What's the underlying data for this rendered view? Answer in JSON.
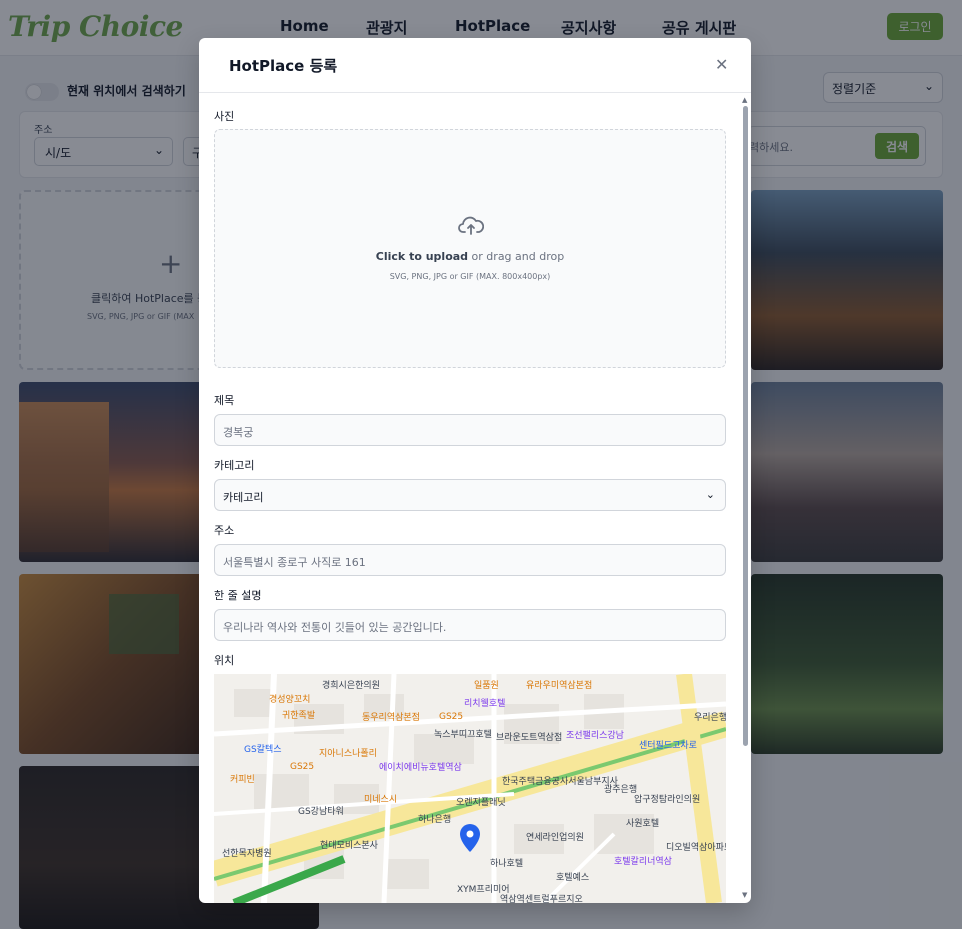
{
  "brand": {
    "logo": "Trip Choice",
    "accent": "#6aa834"
  },
  "nav": {
    "items": [
      "Home",
      "관광지",
      "HotPlace",
      "공지사항",
      "공유 게시판"
    ],
    "login": "로그인"
  },
  "filters": {
    "location_toggle_label": "현재 위치에서 검색하기",
    "sort_value": "정렬기준",
    "address_label": "주소",
    "sido_value": "시/도",
    "gu_value": "구",
    "keyword_placeholder": "력하세요.",
    "search_button": "검색"
  },
  "add_card": {
    "text": "클릭하여 HotPlace를 등",
    "sub": "SVG, PNG, JPG or GIF (MAX"
  },
  "modal": {
    "title": "HotPlace 등록",
    "photo_label": "사진",
    "upload_click": "Click to upload",
    "upload_rest": " or drag and drop",
    "upload_sub": "SVG, PNG, JPG or GIF (MAX. 800x400px)",
    "title_label": "제목",
    "title_value": "경복궁",
    "category_label": "카테고리",
    "category_value": "카테고리",
    "address_label": "주소",
    "address_value": "서울특별시 종로구 사직로 161",
    "desc_label": "한 줄 설명",
    "desc_value": "우리나라 역사와 전통이 깃들어 있는 공간입니다.",
    "location_label": "위치"
  },
  "map_labels": {
    "kyunghee": "경희시은한의원",
    "kyungsung": "경성양꼬치",
    "gwihan": "귀한족발",
    "dongwuri": "동우리역삼본점",
    "gs25a": "GS25",
    "ilpum": "일품원",
    "yuraumi": "유라우미역삼본점",
    "ritz": "리치웰호텔",
    "noksu": "녹스부띠끄호텔",
    "brown": "브라운도트역삼점",
    "chosun": "조선팰리스강남",
    "center": "센터필드고차로",
    "woori": "우리은행",
    "gsmart": "GS칼텍스",
    "zionist": "지아니스나폴리",
    "gs25b": "GS25",
    "ambi": "에이치에비뉴호텔역삼",
    "kfb": "한국주택금융공사서울남부지사",
    "coffee": "커피빈",
    "orange": "오렌지플래닛",
    "kb": "광주은행",
    "apgu": "압구정탐라인의원",
    "misesi": "미네스시",
    "hana": "하나은행",
    "gstower": "GS강남타워",
    "hyundai": "현대모비스본사",
    "yonsei": "연세라인업의원",
    "sawon": "사원호텔",
    "seonhak": "선한목자병원",
    "hanabank": "하나호텔",
    "hotelya": "호텔예스",
    "hotelcl": "호텔칼리너역삼",
    "xym": "XYM프리미어",
    "yeoksam": "역삼역센트럴푸르지오",
    "dimo": "디오빌역삼아파트"
  }
}
